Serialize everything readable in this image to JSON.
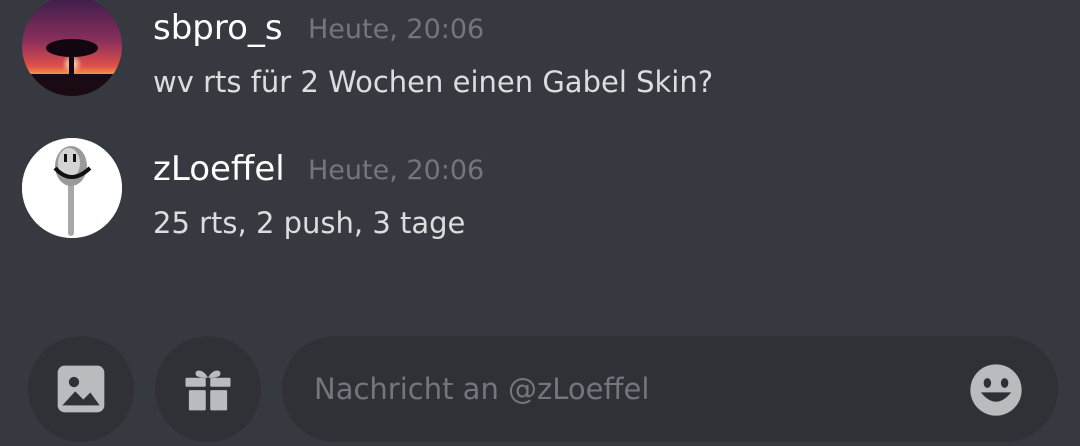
{
  "messages": [
    {
      "username": "sbpro_s",
      "timestamp": "Heute, 20:06",
      "text": "wv rts für 2 Wochen einen Gabel Skin?"
    },
    {
      "username": "zLoeffel",
      "timestamp": "Heute, 20:06",
      "text": "25 rts, 2 push, 3 tage"
    }
  ],
  "composer": {
    "placeholder": "Nachricht an @zLoeffel",
    "value": "",
    "icons": [
      "image-icon",
      "gift-icon",
      "emoji-icon"
    ]
  },
  "colors": {
    "background": "#36393f",
    "surface": "#2f3136",
    "username": "#ffffff",
    "timestamp": "#72767d",
    "text": "#dcddde",
    "icon": "#b9bbbe"
  }
}
